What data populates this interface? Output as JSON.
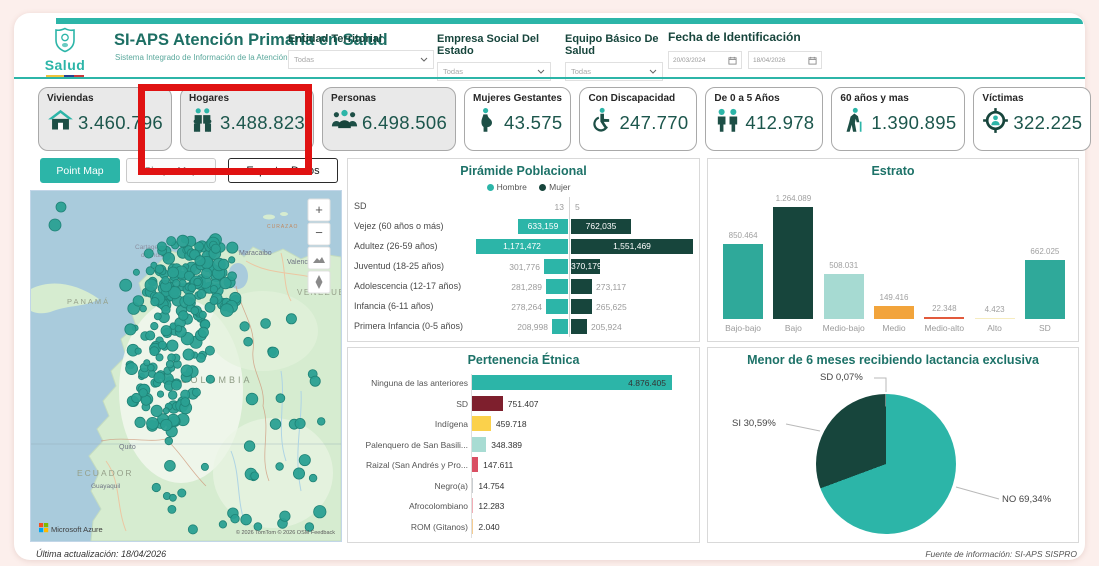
{
  "page": {
    "background": "#fdeeec",
    "accent": "#2CB5A8",
    "dark_accent": "#17453C"
  },
  "header": {
    "logo_text": "Salud",
    "title": "SI-APS Atención Primaria en Salud",
    "subtitle": "Sistema Integrado de Información de la Atención Primaria en Salud",
    "filters": [
      {
        "label": "Entidad Territorial",
        "value": "Todas"
      },
      {
        "label": "Empresa Social Del Estado",
        "value": "Todas"
      },
      {
        "label": "Equipo Básico De Salud",
        "value": "Todas"
      }
    ],
    "date_filter": {
      "label": "Fecha de Identificación",
      "start": "20/03/2024",
      "end": "18/04/2026"
    }
  },
  "kpi_cards": [
    {
      "label": "Viviendas",
      "value": "3.460.796",
      "icon": "house-icon",
      "gray": true
    },
    {
      "label": "Hogares",
      "value": "3.488.823",
      "icon": "family-icon",
      "gray": true,
      "highlighted": true
    },
    {
      "label": "Personas",
      "value": "6.498.506",
      "icon": "people-icon",
      "gray": true
    },
    {
      "label": "Mujeres Gestantes",
      "value": "43.575",
      "icon": "pregnant-icon",
      "gray": false
    },
    {
      "label": "Con Discapacidad",
      "value": "247.770",
      "icon": "wheelchair-icon",
      "gray": false
    },
    {
      "label": "De 0 a 5 Años",
      "value": "412.978",
      "icon": "children-icon",
      "gray": false
    },
    {
      "label": "60 años y mas",
      "value": "1.390.895",
      "icon": "elderly-icon",
      "gray": false
    },
    {
      "label": "Víctimas",
      "value": "322.225",
      "icon": "victim-icon",
      "gray": false
    }
  ],
  "map_toolbar": {
    "point_map": "Point Map",
    "shape_map": "Shape Map",
    "export": "Exportar Datos"
  },
  "map": {
    "labels": [
      "CURAZAO",
      "Cartagena",
      "de Indias",
      "Maracaibo",
      "Valencia",
      "PANAMÁ",
      "VENEZUELA",
      "COLOMBIA",
      "Quito",
      "ECUADOR",
      "Guayaquil"
    ],
    "controls": [
      "zoom-in",
      "zoom-out",
      "style",
      "compass"
    ],
    "attribution": "Microsoft Azure",
    "copyright": "© 2026 TomTom  © 2026 OSM  Feedback",
    "point_color": "#2aa092"
  },
  "annotation": {
    "color": "#e01212"
  },
  "chart_data": [
    {
      "id": "piramide",
      "type": "bar",
      "orientation": "tornado",
      "title": "Pirámide Poblacional",
      "categories": [
        "SD",
        "Vejez (60 años o más)",
        "Adultez (26-59 años)",
        "Juventud (18-25 años)",
        "Adolescencia (12-17 años)",
        "Infancia (6-11 años)",
        "Primera Infancia (0-5 años)"
      ],
      "series": [
        {
          "name": "Hombre",
          "color": "#2CB5A8",
          "values": [
            13,
            633159,
            1171472,
            301776,
            281289,
            278264,
            208998
          ],
          "labels": [
            "13",
            "633,159",
            "1,171,472",
            "301,776",
            "281,289",
            "278,264",
            "208,998"
          ]
        },
        {
          "name": "Mujer",
          "color": "#17453C",
          "values": [
            5,
            762035,
            1551469,
            370179,
            273117,
            265625,
            205924
          ],
          "labels": [
            "5",
            "762,035",
            "1,551,469",
            "370,179",
            "273,117",
            "265,625",
            "205,924"
          ]
        }
      ]
    },
    {
      "id": "estrato",
      "type": "bar",
      "title": "Estrato",
      "categories": [
        "Bajo-bajo",
        "Bajo",
        "Medio-bajo",
        "Medio",
        "Medio-alto",
        "Alto",
        "SD"
      ],
      "values": [
        850464,
        1264089,
        508031,
        149416,
        22348,
        4423,
        662025
      ],
      "labels": [
        "850.464",
        "1.264.089",
        "508.031",
        "149.416",
        "22.348",
        "4.423",
        "662.025"
      ],
      "colors": [
        "#2FA99A",
        "#17453C",
        "#A6DAD2",
        "#F2A43B",
        "#E25A3C",
        "#F6ECC0",
        "#2FA99A"
      ]
    },
    {
      "id": "etnica",
      "type": "bar",
      "orientation": "horizontal",
      "title": "Pertenencia Étnica",
      "categories": [
        "Ninguna de las anteriores",
        "SD",
        "Indígena",
        "Palenquero de San Basili...",
        "Raizal (San Andrés y Pro...",
        "Negro(a)",
        "Afrocolombiano",
        "ROM (Gitanos)"
      ],
      "values": [
        4876405,
        751407,
        459718,
        348389,
        147611,
        14754,
        12283,
        2040
      ],
      "labels": [
        "4.876.405",
        "751.407",
        "459.718",
        "348.389",
        "147.611",
        "14.754",
        "12.283",
        "2.040"
      ],
      "colors": [
        "#2CB5A8",
        "#7E1F2D",
        "#FBD14B",
        "#A8DCD3",
        "#D94F63",
        "#C9CDD0",
        "#F2AEB6",
        "#F6CD92"
      ]
    },
    {
      "id": "lactancia",
      "type": "pie",
      "title": "Menor de 6 meses recibiendo lactancia exclusiva",
      "slices": [
        {
          "label": "NO",
          "pct": 69.34,
          "text": "NO 69,34%",
          "color": "#2CB5A8"
        },
        {
          "label": "SI",
          "pct": 30.59,
          "text": "SI 30,59%",
          "color": "#17453C"
        },
        {
          "label": "SD",
          "pct": 0.07,
          "text": "SD 0,07%",
          "color": "#C6CDCD"
        }
      ]
    }
  ],
  "footer": {
    "left": "Última actualización: 18/04/2026",
    "right": "Fuente de información: SI-APS SISPRO"
  }
}
